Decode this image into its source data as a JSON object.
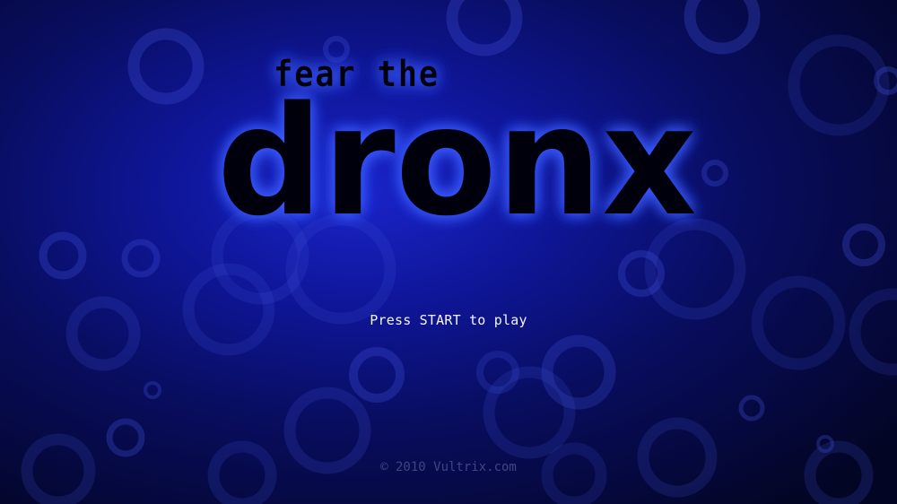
{
  "logo": {
    "line1": "fear the",
    "line2": "dronx"
  },
  "prompt_text": "Press START to play",
  "copyright_text": "© 2010 Vultrix.com",
  "colors": {
    "background_center": "#1a24c9",
    "background_edge": "#030525",
    "logo_fill": "#05060f",
    "logo_glow": "#3a5bff",
    "prompt": "#f2f4ff",
    "copyright": "#3d4684"
  }
}
